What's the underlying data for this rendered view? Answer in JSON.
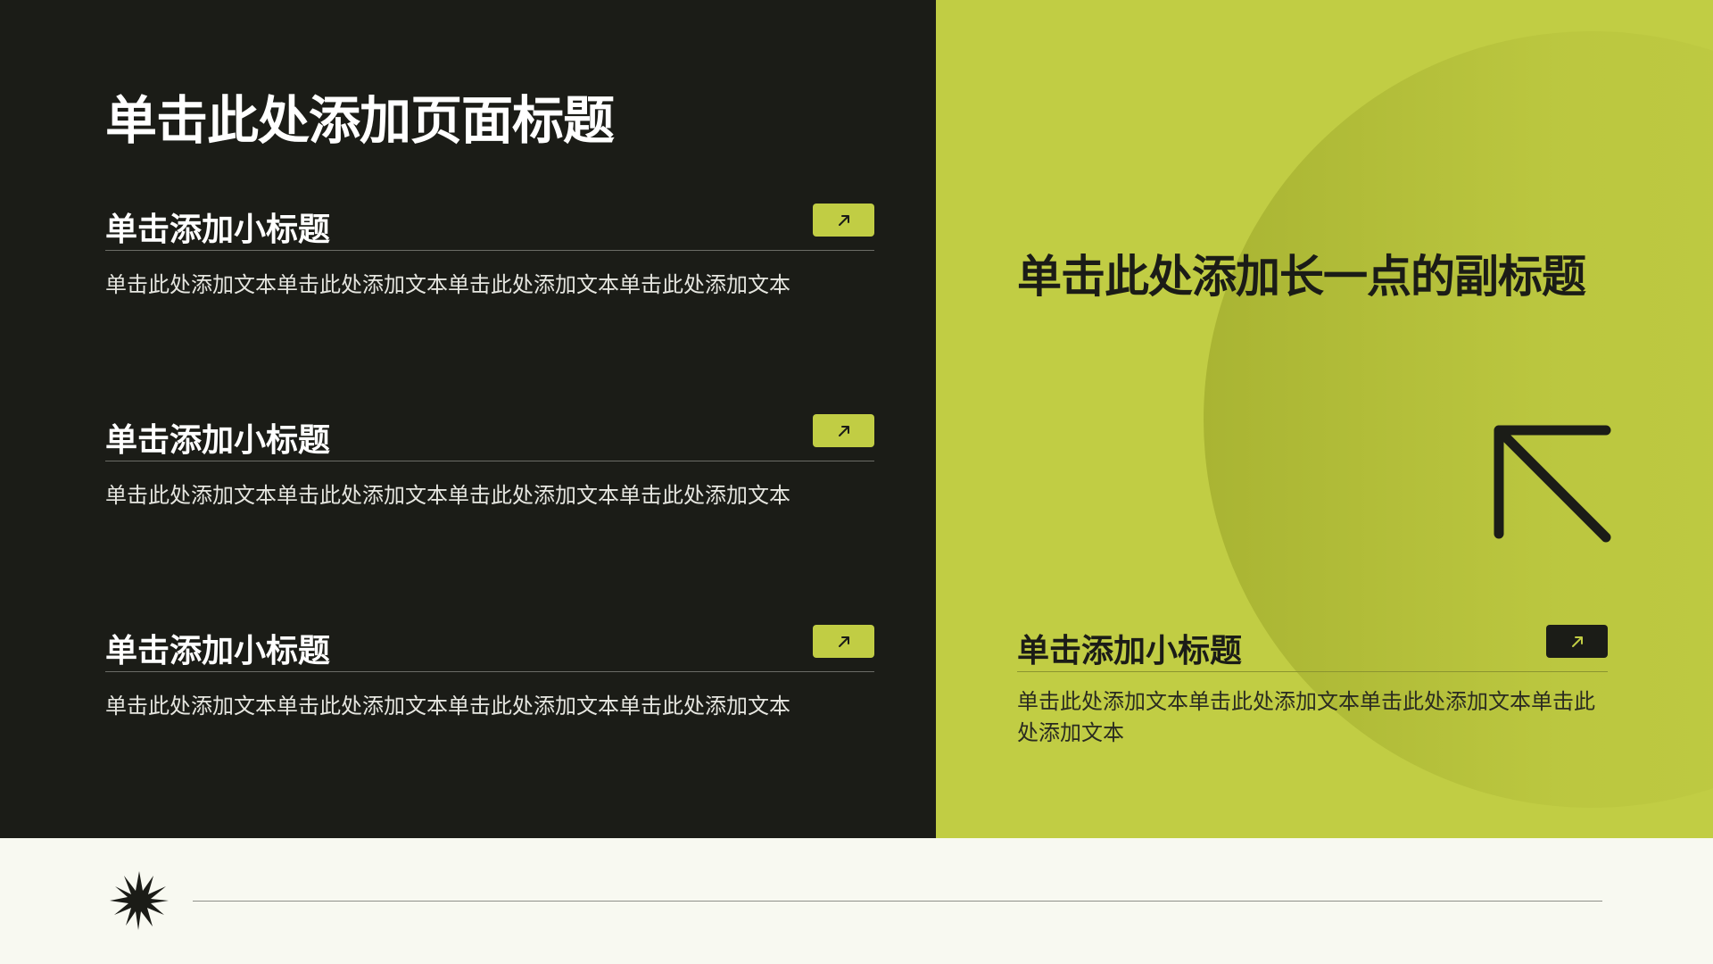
{
  "page_title": "单击此处添加页面标题",
  "left_sections": [
    {
      "title": "单击添加小标题",
      "text": "单击此处添加文本单击此处添加文本单击此处添加文本单击此处添加文本"
    },
    {
      "title": "单击添加小标题",
      "text": "单击此处添加文本单击此处添加文本单击此处添加文本单击此处添加文本"
    },
    {
      "title": "单击添加小标题",
      "text": "单击此处添加文本单击此处添加文本单击此处添加文本单击此处添加文本"
    }
  ],
  "right_panel": {
    "subtitle": "单击此处添加长一点的副标题",
    "section": {
      "title": "单击添加小标题",
      "text": "单击此处添加文本单击此处添加文本单击此处添加文本单击此处添加文本"
    }
  },
  "colors": {
    "dark": "#1b1c17",
    "accent": "#c1cd44",
    "background": "#f8f9f1"
  },
  "icons": {
    "small_arrow": "arrow-up-right-icon",
    "big_arrow": "arrow-up-left-icon",
    "footer_mark": "starburst-icon"
  }
}
